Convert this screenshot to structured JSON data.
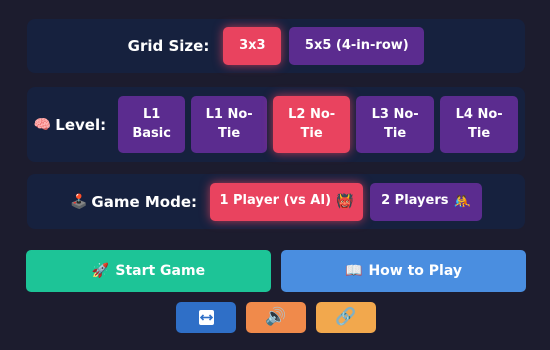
{
  "grid": {
    "label": "Grid Size:",
    "options": [
      "3x3",
      "5x5 (4-in-row)"
    ],
    "selected": "3x3"
  },
  "level": {
    "icon": "brain-icon",
    "label": "Level:",
    "options": [
      [
        "L1",
        "Basic"
      ],
      [
        "L1 No-",
        "Tie"
      ],
      [
        "L2 No-",
        "Tie"
      ],
      [
        "L3 No-",
        "Tie"
      ],
      [
        "L4 No-",
        "Tie"
      ]
    ],
    "selected_index": 2
  },
  "mode": {
    "icon": "joystick-icon",
    "label": "Game Mode:",
    "options": [
      {
        "label": "1 Player (vs AI)",
        "icon": "ogre-icon"
      },
      {
        "label": "2 Players",
        "icon": "people-icon"
      }
    ],
    "selected_index": 0
  },
  "actions": {
    "start": {
      "label": "Start Game",
      "icon": "rocket-icon"
    },
    "howto": {
      "label": "How to Play",
      "icon": "book-icon"
    }
  },
  "tools": [
    {
      "icon": "swap-arrows-icon",
      "color": "#2f6fc7"
    },
    {
      "icon": "speaker-icon",
      "color": "#f08a4b"
    },
    {
      "icon": "link-icon",
      "color": "#f2a84d"
    }
  ],
  "colors": {
    "background": "#1c1c2e",
    "panel": "#16213e",
    "option": "#5b2c8f",
    "active": "#e9435f",
    "start": "#1dc497",
    "howto": "#4a8ee0"
  }
}
